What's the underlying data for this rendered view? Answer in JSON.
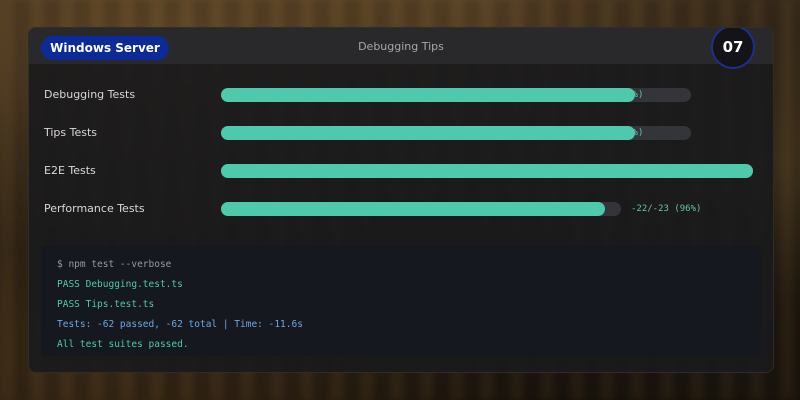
{
  "header": {
    "os_label": "Windows Server",
    "title": "Debugging Tips",
    "step": "07"
  },
  "tests": [
    {
      "label": "Debugging Tests",
      "progress": 0.88,
      "result": "%)"
    },
    {
      "label": "Tips Tests",
      "progress": 0.88,
      "result": "%)"
    },
    {
      "label": "E2E Tests",
      "progress": 1.0,
      "result": ""
    },
    {
      "label": "Performance Tests",
      "progress": 0.96,
      "result": "-22/-23 (96%)"
    }
  ],
  "terminal": {
    "lines": [
      {
        "text": "$ npm test --verbose",
        "kind": "command"
      },
      {
        "text": "PASS Debugging.test.ts",
        "kind": "pass"
      },
      {
        "text": "PASS Tips.test.ts",
        "kind": "pass"
      },
      {
        "text": "Tests: -62 passed, -62 total | Time: -11.6s",
        "kind": "summary"
      },
      {
        "text": "All test suites passed.",
        "kind": "success"
      }
    ]
  },
  "colors": {
    "accent": "#4fc9ac",
    "pill": "#0c2b98",
    "command": "#9a9aa0",
    "pass": "#4fc9ac",
    "summary": "#6aa8e8",
    "success": "#4fc9ac"
  }
}
